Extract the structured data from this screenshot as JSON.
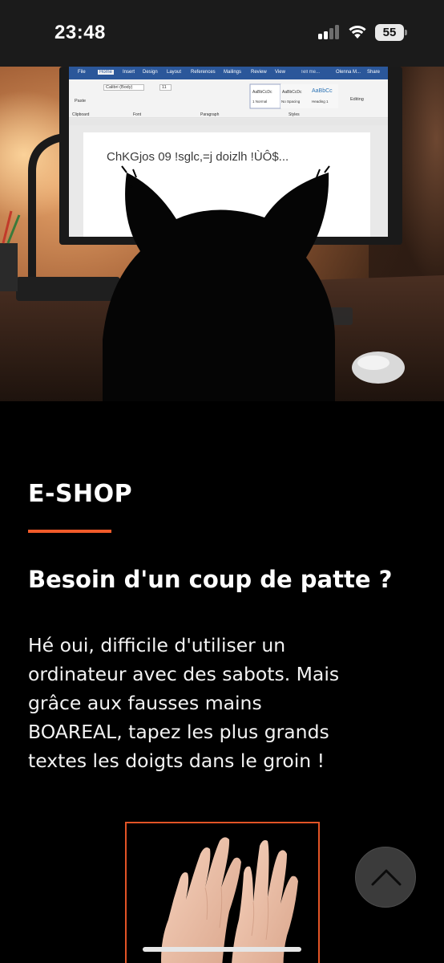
{
  "status_bar": {
    "time": "23:48",
    "battery_level": "55",
    "icons": [
      "cellular-signal-icon",
      "wifi-icon",
      "battery-icon"
    ]
  },
  "hero": {
    "word_tabs": [
      "File",
      "Home",
      "Insert",
      "Design",
      "Layout",
      "References",
      "Mailings",
      "Review",
      "View",
      "Tell me...",
      "Olenna M...",
      "Share"
    ],
    "word_font": "Calibri (Body)",
    "word_font_size": "11",
    "word_styles": [
      "AaBbCcDc",
      "AaBbCcDc",
      "AaBbCc"
    ],
    "word_style_names": [
      "1 Normal",
      "No Spacing",
      "Heading 1"
    ],
    "word_groups": [
      "Clipboard",
      "Font",
      "Paragraph",
      "Styles"
    ],
    "word_paste": "Paste",
    "word_editing": "Editing",
    "document_text": "ChKGjos 09 !sglc,=j doizlh !ÙÔ$..."
  },
  "content": {
    "section_label": "E-SHOP",
    "heading": "Besoin d'un coup de patte ?",
    "description_lines": [
      "Hé oui, difficile d'utiliser un",
      "ordinateur avec des sabots. Mais",
      "grâce aux fausses mains",
      "BOAREAL, tapez les plus grands",
      "textes les doigts dans le groin !"
    ]
  },
  "colors": {
    "accent": "#f25b2a",
    "background": "#000000",
    "status_bar": "#1b1b1b",
    "word_blue": "#2b579a"
  }
}
